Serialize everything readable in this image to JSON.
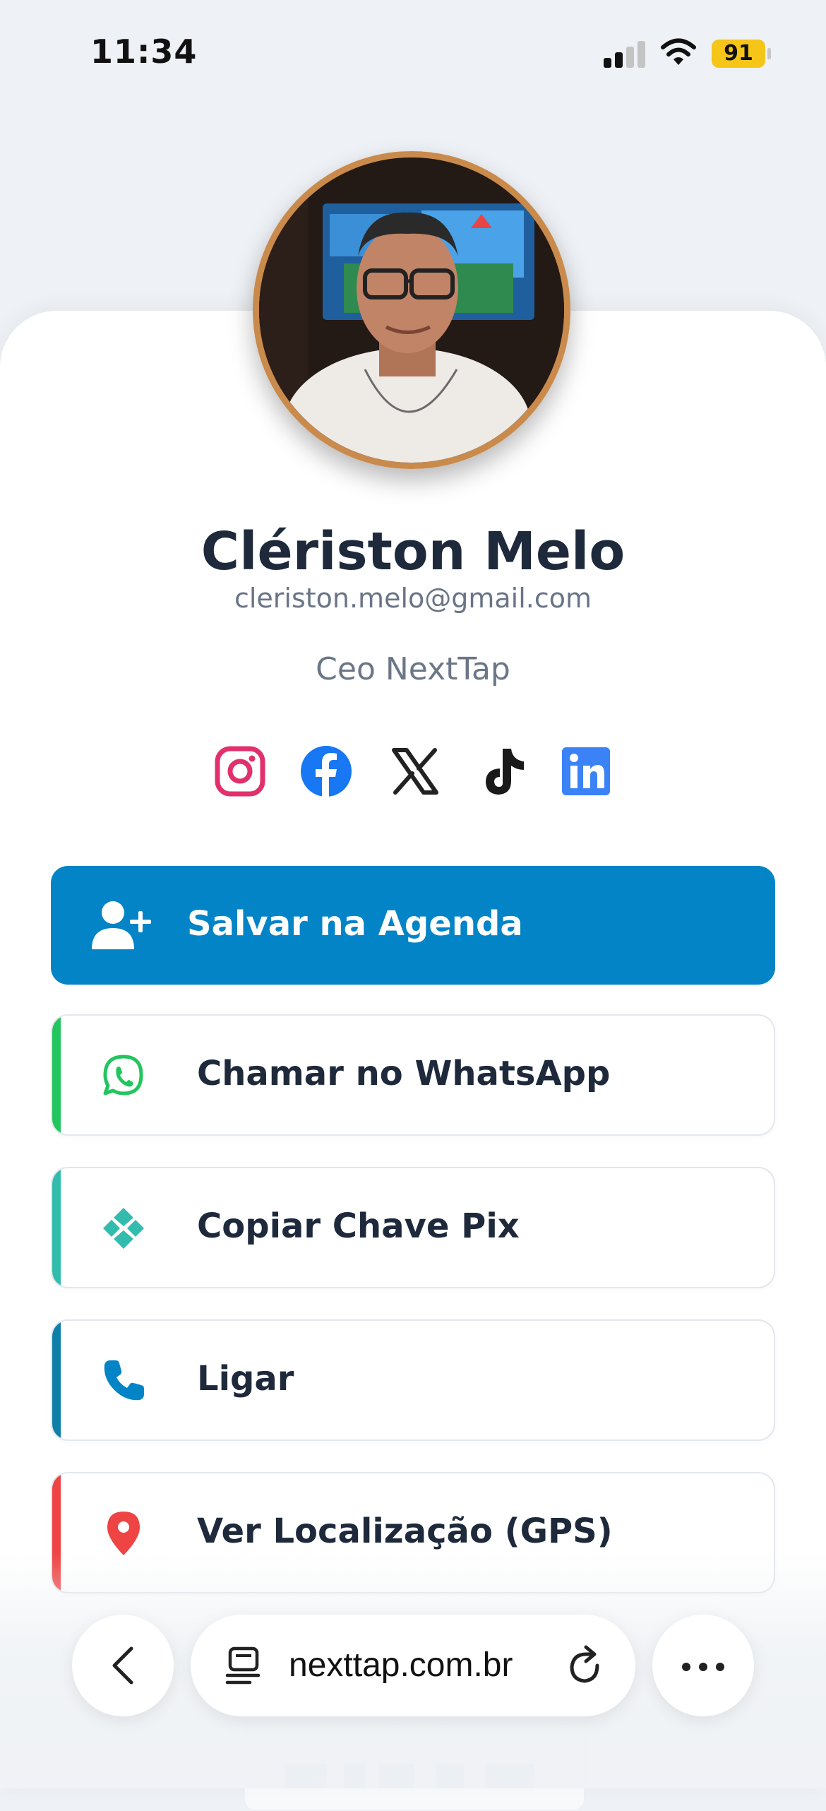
{
  "status_bar": {
    "time": "11:34",
    "battery": "91"
  },
  "profile": {
    "name": "Clériston Melo",
    "email": "cleriston.melo@gmail.com",
    "role": "Ceo NextTap"
  },
  "socials": [
    "instagram-icon",
    "facebook-icon",
    "x-icon",
    "tiktok-icon",
    "linkedin-icon"
  ],
  "primary_action": {
    "label": "Salvar na Agenda",
    "icon": "add-user-icon",
    "color": "#0284c7"
  },
  "actions": [
    {
      "label": "Chamar no WhatsApp",
      "icon": "whatsapp-icon",
      "accent": "#22c55e"
    },
    {
      "label": "Copiar Chave Pix",
      "icon": "pix-icon",
      "accent": "#32bcad"
    },
    {
      "label": "Ligar",
      "icon": "phone-icon",
      "accent": "#0e7fa8"
    },
    {
      "label": "Ver Localização (GPS)",
      "icon": "location-pin-icon",
      "accent": "#ef4444"
    }
  ],
  "browser": {
    "url": "nexttap.com.br"
  }
}
